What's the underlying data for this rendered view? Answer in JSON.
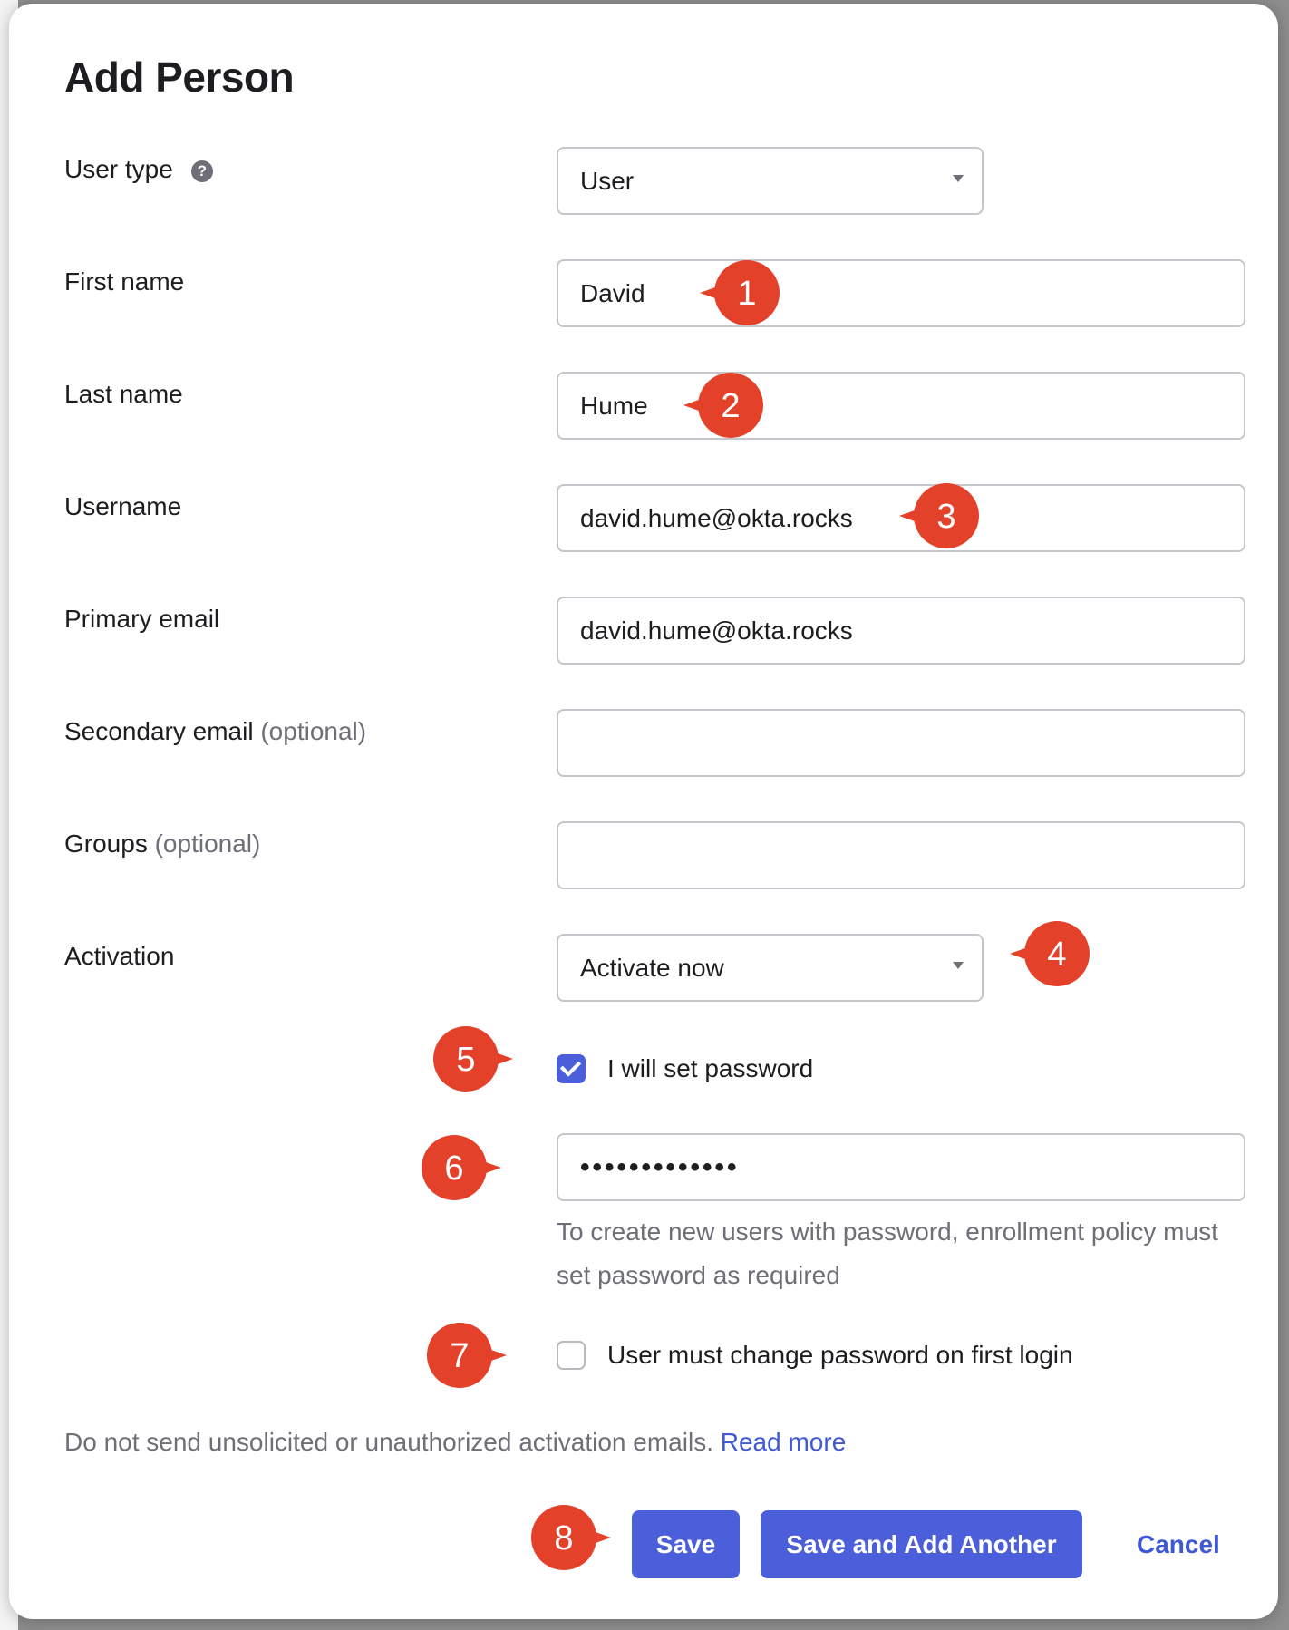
{
  "dialog": {
    "title": "Add Person"
  },
  "form": {
    "user_type": {
      "label": "User type",
      "value": "User",
      "help_icon": "?"
    },
    "first_name": {
      "label": "First name",
      "value": "David"
    },
    "last_name": {
      "label": "Last name",
      "value": "Hume"
    },
    "username": {
      "label": "Username",
      "value": "david.hume@okta.rocks"
    },
    "primary_email": {
      "label": "Primary email",
      "value": "david.hume@okta.rocks"
    },
    "secondary_email": {
      "label": "Secondary email",
      "optional": "(optional)",
      "value": ""
    },
    "groups": {
      "label": "Groups",
      "optional": "(optional)",
      "value": ""
    },
    "activation": {
      "label": "Activation",
      "value": "Activate now"
    },
    "set_password": {
      "label": "I will set password",
      "checked": true
    },
    "password": {
      "value": "•••••••••••••"
    },
    "password_hint": "To create new users with password, enrollment policy must set password as required",
    "change_on_login": {
      "label": "User must change password on first login",
      "checked": false
    }
  },
  "disclaimer": {
    "text": "Do not send unsolicited or unauthorized activation emails.",
    "link": "Read more"
  },
  "buttons": {
    "save": "Save",
    "save_and_add": "Save and Add Another",
    "cancel": "Cancel"
  },
  "step_markers": [
    "1",
    "2",
    "3",
    "4",
    "5",
    "6",
    "7",
    "8"
  ],
  "colors": {
    "accent": "#4a5fd9",
    "link": "#3e58d6",
    "marker": "#e4412a",
    "text": "#1d1d21",
    "muted": "#6e6e78"
  }
}
